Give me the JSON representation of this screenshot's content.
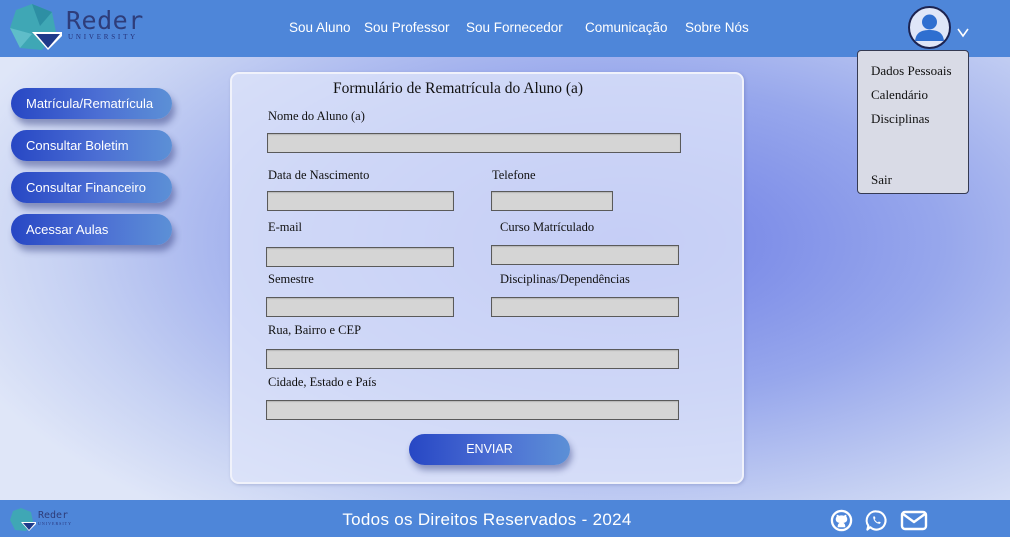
{
  "brand": {
    "name": "Reder",
    "subtitle": "UNIVERSITY"
  },
  "nav": {
    "items": [
      "Sou Aluno",
      "Sou Professor",
      "Sou Fornecedor",
      "Comunicação",
      "Sobre Nós"
    ]
  },
  "user_menu": {
    "icon": "user-avatar-icon",
    "items": [
      "Dados Pessoais",
      "Calendário",
      "Disciplinas",
      "Sair"
    ]
  },
  "sidebar": {
    "items": [
      "Matrícula/Rematrícula",
      "Consultar Boletim",
      "Consultar Financeiro",
      "Acessar Aulas"
    ]
  },
  "form": {
    "title": "Formulário de  Rematrícula do Aluno (a)",
    "fields": {
      "nome": {
        "label": "Nome do Aluno (a)",
        "value": ""
      },
      "nascimento": {
        "label": "Data de Nascimento",
        "value": ""
      },
      "telefone": {
        "label": "Telefone",
        "value": ""
      },
      "email": {
        "label": "E-mail",
        "value": ""
      },
      "curso": {
        "label": "Curso Matrículado",
        "value": ""
      },
      "semestre": {
        "label": "Semestre",
        "value": ""
      },
      "disciplinas": {
        "label": "Disciplinas/Dependências",
        "value": ""
      },
      "endereco": {
        "label": "Rua, Bairro e CEP",
        "value": ""
      },
      "cidade": {
        "label": "Cidade, Estado e País",
        "value": ""
      }
    },
    "submit_label": "ENVIAR"
  },
  "footer": {
    "copyright": "Todos os Direitos Reservados - 2024",
    "icons": [
      "github-icon",
      "whatsapp-icon",
      "mail-icon"
    ]
  },
  "colors": {
    "header": "#4e86d9",
    "button_start": "#2747c4",
    "button_end": "#5c90d6",
    "field": "#d5d5d5"
  }
}
